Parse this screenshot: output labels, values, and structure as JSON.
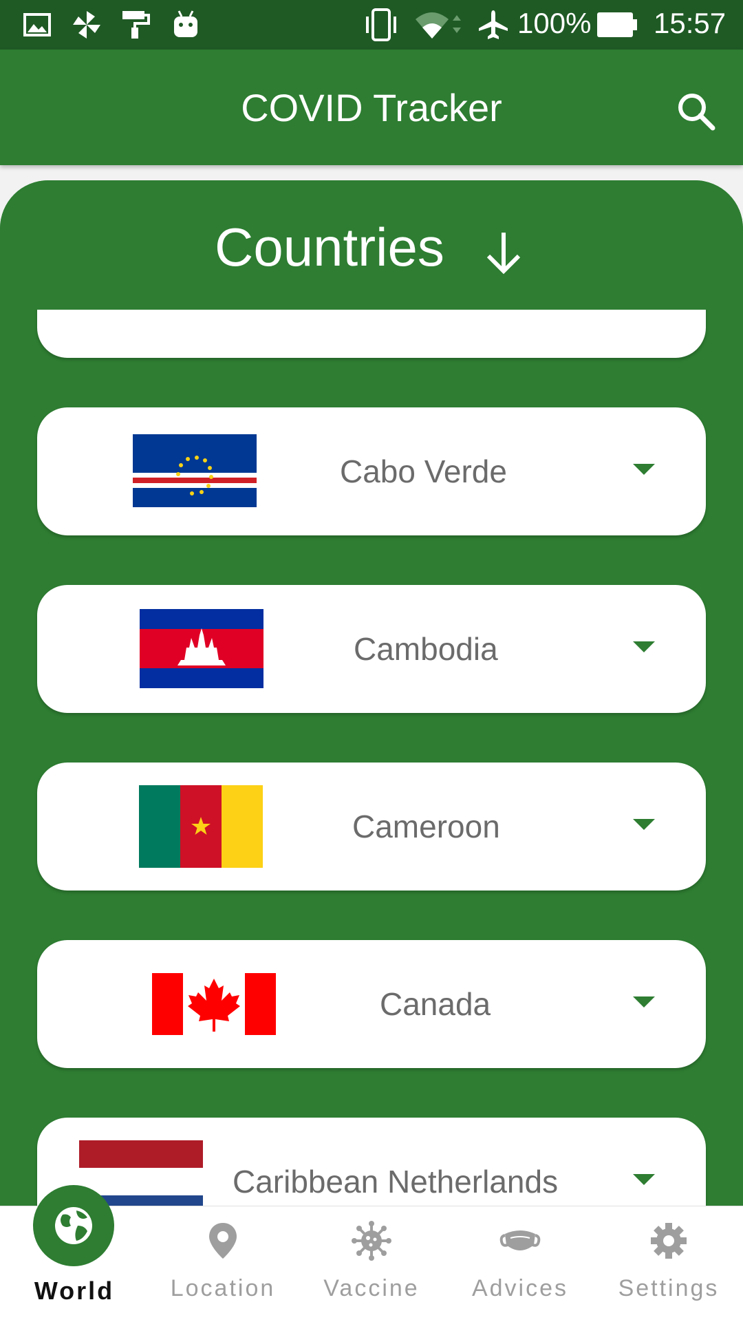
{
  "status_bar": {
    "battery_percent": "100%",
    "time": "15:57"
  },
  "app_bar": {
    "title": "COVID Tracker",
    "search_icon": "search-icon"
  },
  "panel": {
    "title": "Countries",
    "sort_icon": "arrow-down-icon"
  },
  "countries": [
    {
      "name": "Cabo Verde",
      "flag": "cabo-verde-flag"
    },
    {
      "name": "Cambodia",
      "flag": "cambodia-flag"
    },
    {
      "name": "Cameroon",
      "flag": "cameroon-flag"
    },
    {
      "name": "Canada",
      "flag": "canada-flag"
    },
    {
      "name": "Caribbean Netherlands",
      "flag": "netherlands-flag"
    }
  ],
  "bottom_nav": {
    "items": [
      {
        "label": "World",
        "icon": "globe-icon",
        "active": true
      },
      {
        "label": "Location",
        "icon": "location-pin-icon",
        "active": false
      },
      {
        "label": "Vaccine",
        "icon": "virus-icon",
        "active": false
      },
      {
        "label": "Advices",
        "icon": "mask-icon",
        "active": false
      },
      {
        "label": "Settings",
        "icon": "gear-icon",
        "active": false
      }
    ]
  },
  "colors": {
    "primary": "#2e7d32",
    "status_bar": "#1f5a25",
    "card_text": "#6b6b6b",
    "nav_inactive": "#9e9e9e"
  }
}
